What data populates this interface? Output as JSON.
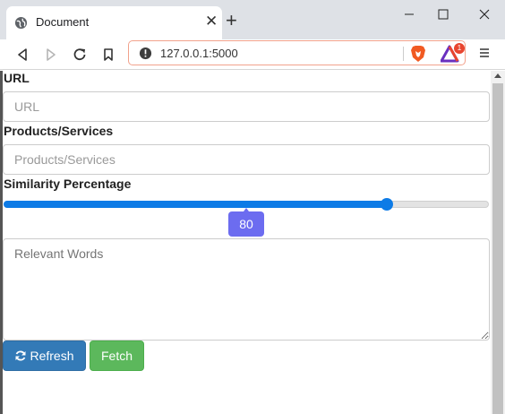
{
  "browser": {
    "tab_title": "Document",
    "url": "127.0.0.1:5000",
    "rewards_badge": "1"
  },
  "form": {
    "url_label": "URL",
    "url_placeholder": "URL",
    "products_label": "Products/Services",
    "products_placeholder": "Products/Services",
    "similarity_label": "Similarity Percentage",
    "similarity_value": "80",
    "similarity_fraction": 0.79,
    "relevant_placeholder": "Relevant Words",
    "refresh_label": "Refresh",
    "fetch_label": "Fetch"
  },
  "colors": {
    "slider_fill": "#0d7be6",
    "bubble": "#6c6cf0",
    "refresh_button": "#337ab7",
    "fetch_button": "#5cb85c"
  },
  "icons": [
    "globe-icon",
    "close-icon",
    "plus-icon",
    "minimize-icon",
    "maximize-icon",
    "window-close-icon",
    "back-icon",
    "forward-icon",
    "reload-icon",
    "bookmark-icon",
    "info-icon",
    "brave-lion-icon",
    "rewards-icon",
    "menu-icon",
    "refresh-icon"
  ]
}
